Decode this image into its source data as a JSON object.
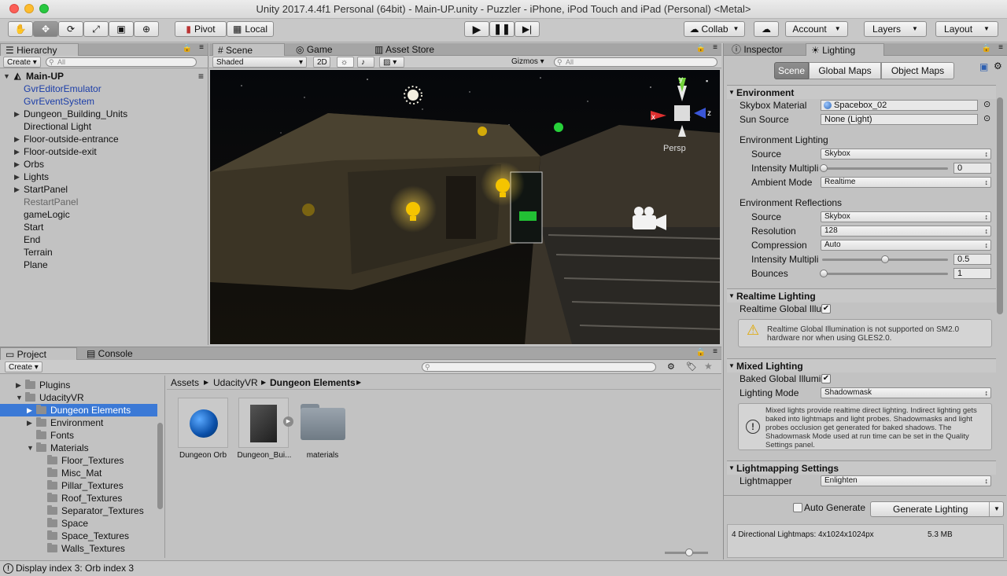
{
  "window": {
    "title": "Unity 2017.4.4f1 Personal (64bit) - Main-UP.unity - Puzzler - iPhone, iPod Touch and iPad (Personal) <Metal>"
  },
  "toolbar": {
    "pivot": "Pivot",
    "local": "Local",
    "collab": "Collab",
    "account": "Account",
    "layers": "Layers",
    "layout": "Layout"
  },
  "hierarchy": {
    "tab": "Hierarchy",
    "create": "Create",
    "search_placeholder": "All",
    "scene": "Main-UP",
    "items": [
      "GvrEditorEmulator",
      "GvrEventSystem",
      "Dungeon_Building_Units",
      "Directional Light",
      "Floor-outside-entrance",
      "Floor-outside-exit",
      "Orbs",
      "Lights",
      "StartPanel",
      "RestartPanel",
      "gameLogic",
      "Start",
      "End",
      "Terrain",
      "Plane"
    ]
  },
  "scene_tabs": {
    "scene": "Scene",
    "game": "Game",
    "asset_store": "Asset Store"
  },
  "scene_bar": {
    "shading": "Shaded",
    "mode2d": "2D",
    "gizmos": "Gizmos",
    "search_placeholder": "All",
    "persp": "Persp",
    "axis_x": "x",
    "axis_y": "y",
    "axis_z": "z"
  },
  "project": {
    "tab": "Project",
    "console_tab": "Console",
    "create": "Create",
    "tree": [
      {
        "label": "Plugins"
      },
      {
        "label": "UdacityVR"
      },
      {
        "label": "Dungeon Elements"
      },
      {
        "label": "Environment"
      },
      {
        "label": "Fonts"
      },
      {
        "label": "Materials"
      },
      {
        "label": "Floor_Textures"
      },
      {
        "label": "Misc_Mat"
      },
      {
        "label": "Pillar_Textures"
      },
      {
        "label": "Roof_Textures"
      },
      {
        "label": "Separator_Textures"
      },
      {
        "label": "Space"
      },
      {
        "label": "Space_Textures"
      },
      {
        "label": "Walls_Textures"
      }
    ],
    "breadcrumb": [
      "Assets",
      "UdacityVR",
      "Dungeon Elements"
    ],
    "assets": [
      "Dungeon Orb",
      "Dungeon_Bui...",
      "materials"
    ]
  },
  "status": {
    "text": "Display index 3: Orb index 3"
  },
  "inspector": {
    "inspector_tab": "Inspector",
    "lighting_tab": "Lighting",
    "subtabs": [
      "Scene",
      "Global Maps",
      "Object Maps"
    ],
    "environment": {
      "header": "Environment",
      "skybox_label": "Skybox Material",
      "skybox_value": "Spacebox_02",
      "sun_label": "Sun Source",
      "sun_value": "None (Light)",
      "lighting_header": "Environment Lighting",
      "source_label": "Source",
      "source_value": "Skybox",
      "intensity_label": "Intensity Multipli",
      "intensity_value": "0",
      "ambient_label": "Ambient Mode",
      "ambient_value": "Realtime",
      "refl_header": "Environment Reflections",
      "refl_source_label": "Source",
      "refl_source_value": "Skybox",
      "resolution_label": "Resolution",
      "resolution_value": "128",
      "compression_label": "Compression",
      "compression_value": "Auto",
      "refl_intensity_label": "Intensity Multipli",
      "refl_intensity_value": "0.5",
      "bounces_label": "Bounces",
      "bounces_value": "1"
    },
    "realtime": {
      "header": "Realtime Lighting",
      "gi_label": "Realtime Global Illu",
      "warning": "Realtime Global Illumination is not supported on SM2.0 hardware nor when using GLES2.0."
    },
    "mixed": {
      "header": "Mixed Lighting",
      "baked_label": "Baked Global Illumi",
      "mode_label": "Lighting Mode",
      "mode_value": "Shadowmask",
      "info": "Mixed lights provide realtime direct lighting. Indirect lighting gets baked into lightmaps and light probes. Shadowmasks and light probes occlusion get generated for baked shadows. The Shadowmask Mode used at run time can be set in the Quality Settings panel."
    },
    "lightmapping": {
      "header": "Lightmapping Settings",
      "lightmapper_label": "Lightmapper",
      "lightmapper_value": "Enlighten"
    },
    "auto_generate": "Auto Generate",
    "generate_button": "Generate Lighting",
    "footer_lightmaps": "4 Directional Lightmaps: 4x1024x1024px",
    "footer_size": "5.3 MB"
  },
  "colors": {
    "accent_selection": "#3b79d6",
    "prefab_blue": "#1c3ea8",
    "disabled_gray": "#666666"
  }
}
